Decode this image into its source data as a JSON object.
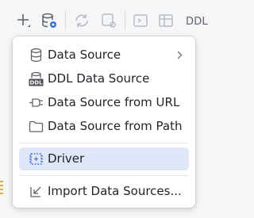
{
  "toolbar": {
    "add_icon": "plus-icon",
    "datasource_icon": "database-settings-icon",
    "refresh_icon": "refresh-icon",
    "ddl_label": "DDL"
  },
  "menu": {
    "items": [
      {
        "label": "Data Source",
        "icon": "database-icon",
        "has_submenu": true
      },
      {
        "label": "DDL Data Source",
        "icon": "ddl-icon"
      },
      {
        "label": "Data Source from URL",
        "icon": "plug-icon"
      },
      {
        "label": "Data Source from Path",
        "icon": "folder-icon"
      },
      {
        "label": "Driver",
        "icon": "driver-icon",
        "selected": true
      },
      {
        "label": "Import Data Sources...",
        "icon": "import-arrow-icon"
      }
    ]
  },
  "colors": {
    "selected_bg": "#dfe6f7",
    "accent_blue": "#3a6fd8",
    "text": "#1f2329"
  }
}
